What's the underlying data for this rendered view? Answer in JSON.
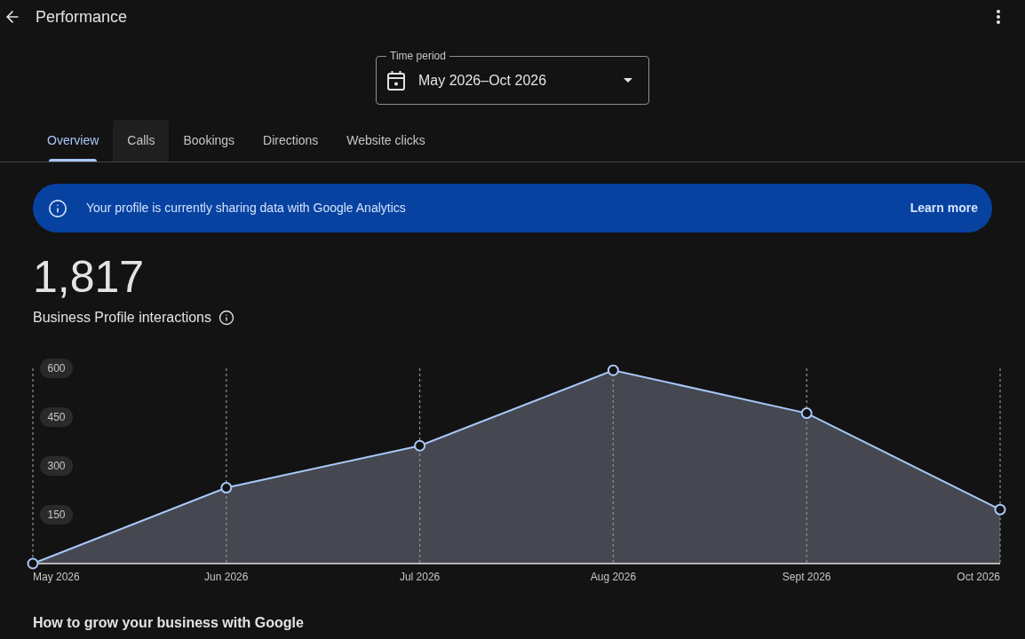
{
  "header": {
    "title": "Performance"
  },
  "time_period": {
    "label": "Time period",
    "value": "May 2026–Oct 2026"
  },
  "tabs": [
    {
      "label": "Overview",
      "selected": true,
      "hovered": false
    },
    {
      "label": "Calls",
      "selected": false,
      "hovered": true
    },
    {
      "label": "Bookings",
      "selected": false,
      "hovered": false
    },
    {
      "label": "Directions",
      "selected": false,
      "hovered": false
    },
    {
      "label": "Website clicks",
      "selected": false,
      "hovered": false
    }
  ],
  "banner": {
    "message": "Your profile is currently sharing data with Google Analytics",
    "action": "Learn more"
  },
  "performance": {
    "total": "1,817",
    "label": "Business Profile interactions",
    "chart_data": {
      "type": "area",
      "categories": [
        "May 2026",
        "Jun 2026",
        "Jul 2026",
        "Aug 2026",
        "Sept 2026",
        "Oct 2026"
      ],
      "series": [
        {
          "color": "#a8c7fa",
          "values": [
            0,
            233,
            362,
            594,
            462,
            166
          ]
        }
      ],
      "ylim": [
        0,
        600
      ],
      "yticks": [
        150,
        300,
        450,
        600
      ],
      "grid": true
    }
  },
  "section_title": "How to grow your business with Google"
}
